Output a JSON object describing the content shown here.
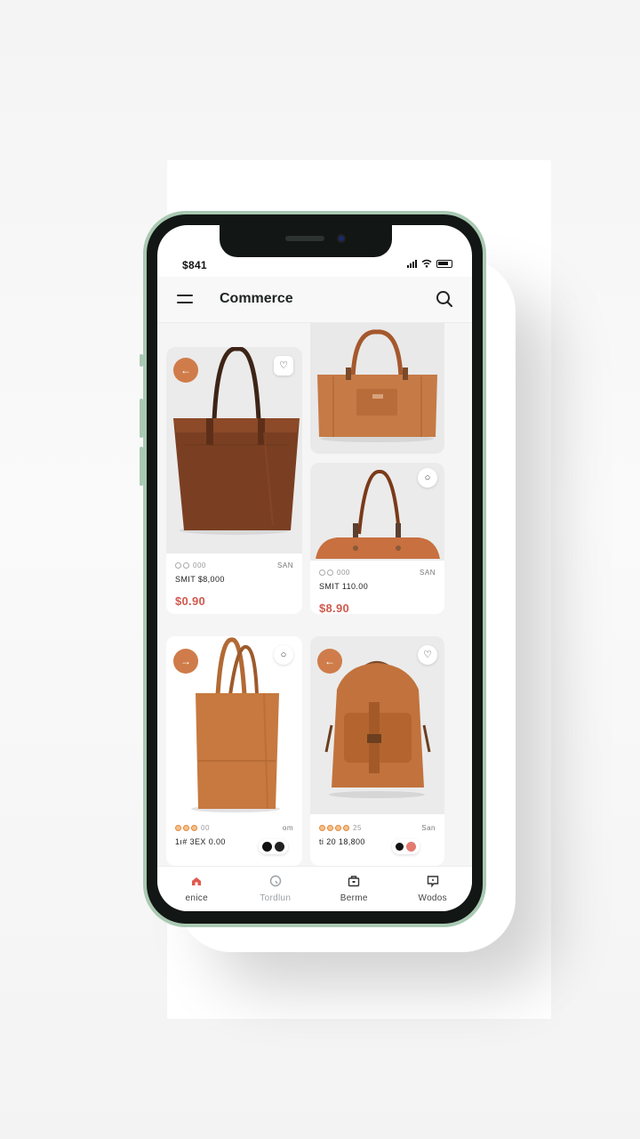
{
  "status_bar": {
    "time": "$841"
  },
  "header": {
    "title": "Commerce"
  },
  "products": [
    {
      "rating_text": "000",
      "right_label": "SAN",
      "name": "SMIT $8,000",
      "price": "$0.90",
      "has_arrow": true,
      "arrow_glyph": "←",
      "fav_icon": "heart-icon"
    },
    {
      "fav_icon": "none"
    },
    {
      "rating_text": "000",
      "right_label": "SAN",
      "name": "SMIT 110.00",
      "price": "$8.90",
      "fav_icon": "circle-icon"
    },
    {
      "rating_text": "00",
      "right_label": "om",
      "name": "1ı# 3EX 0.00",
      "arrow_glyph": "→",
      "fav_icon": "circle-icon"
    },
    {
      "rating_text": "25",
      "right_label": "San",
      "name": "ti 20 18,800",
      "arrow_glyph": "←",
      "fav_icon": "heart-icon"
    }
  ],
  "bottom_nav": [
    {
      "label": "enice",
      "icon": "home-icon",
      "color": "#e05a4e"
    },
    {
      "label": "Tordlun",
      "icon": "refresh-icon",
      "color": "#9aa0a4"
    },
    {
      "label": "Berme",
      "icon": "bag-icon",
      "color": "#333333"
    },
    {
      "label": "Wodos",
      "icon": "chat-icon",
      "color": "#333333"
    }
  ],
  "colors": {
    "accent": "#cf7c4a",
    "price": "#d05a4e",
    "phone_frame": "#a9c9b2"
  }
}
